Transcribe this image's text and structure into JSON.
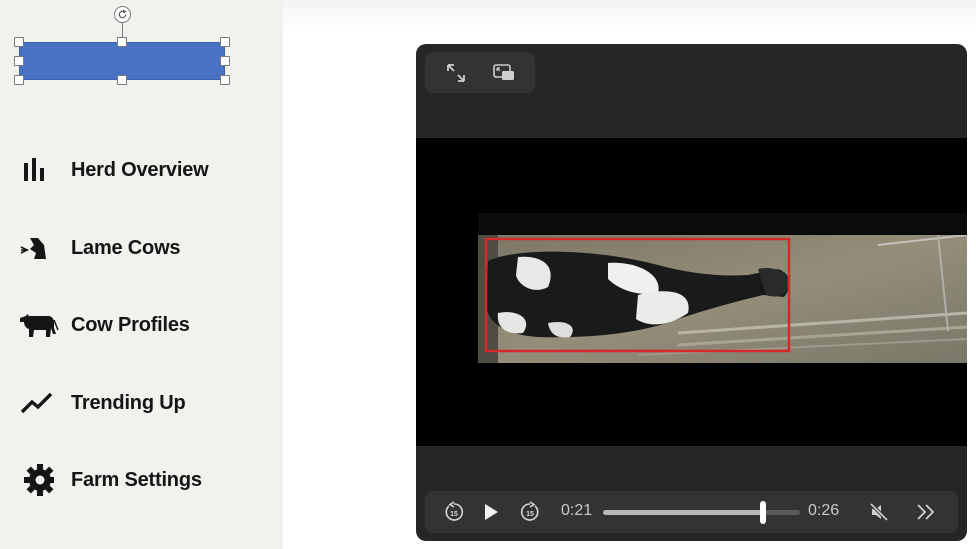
{
  "sidebar": {
    "nav_items": [
      {
        "label": "Herd Overview",
        "icon": "bar-chart-icon"
      },
      {
        "label": "Lame Cows",
        "icon": "lame-cow-icon"
      },
      {
        "label": "Cow Profiles",
        "icon": "cow-icon"
      },
      {
        "label": "Trending Up",
        "icon": "trending-up-icon"
      },
      {
        "label": "Farm Settings",
        "icon": "gear-icon"
      }
    ]
  },
  "player": {
    "toolbar": {
      "expand_icon": "expand-icon",
      "pip_icon": "picture-in-picture-icon"
    },
    "controls": {
      "current_time": "0:21",
      "duration": "0:26",
      "progress": 0.81,
      "muted": true
    },
    "detection_box_color": "#d42a2a"
  },
  "colors": {
    "sidebar_bg": "#f1f1ee",
    "shape_fill": "#4a72c4",
    "player_bg": "#262626"
  }
}
